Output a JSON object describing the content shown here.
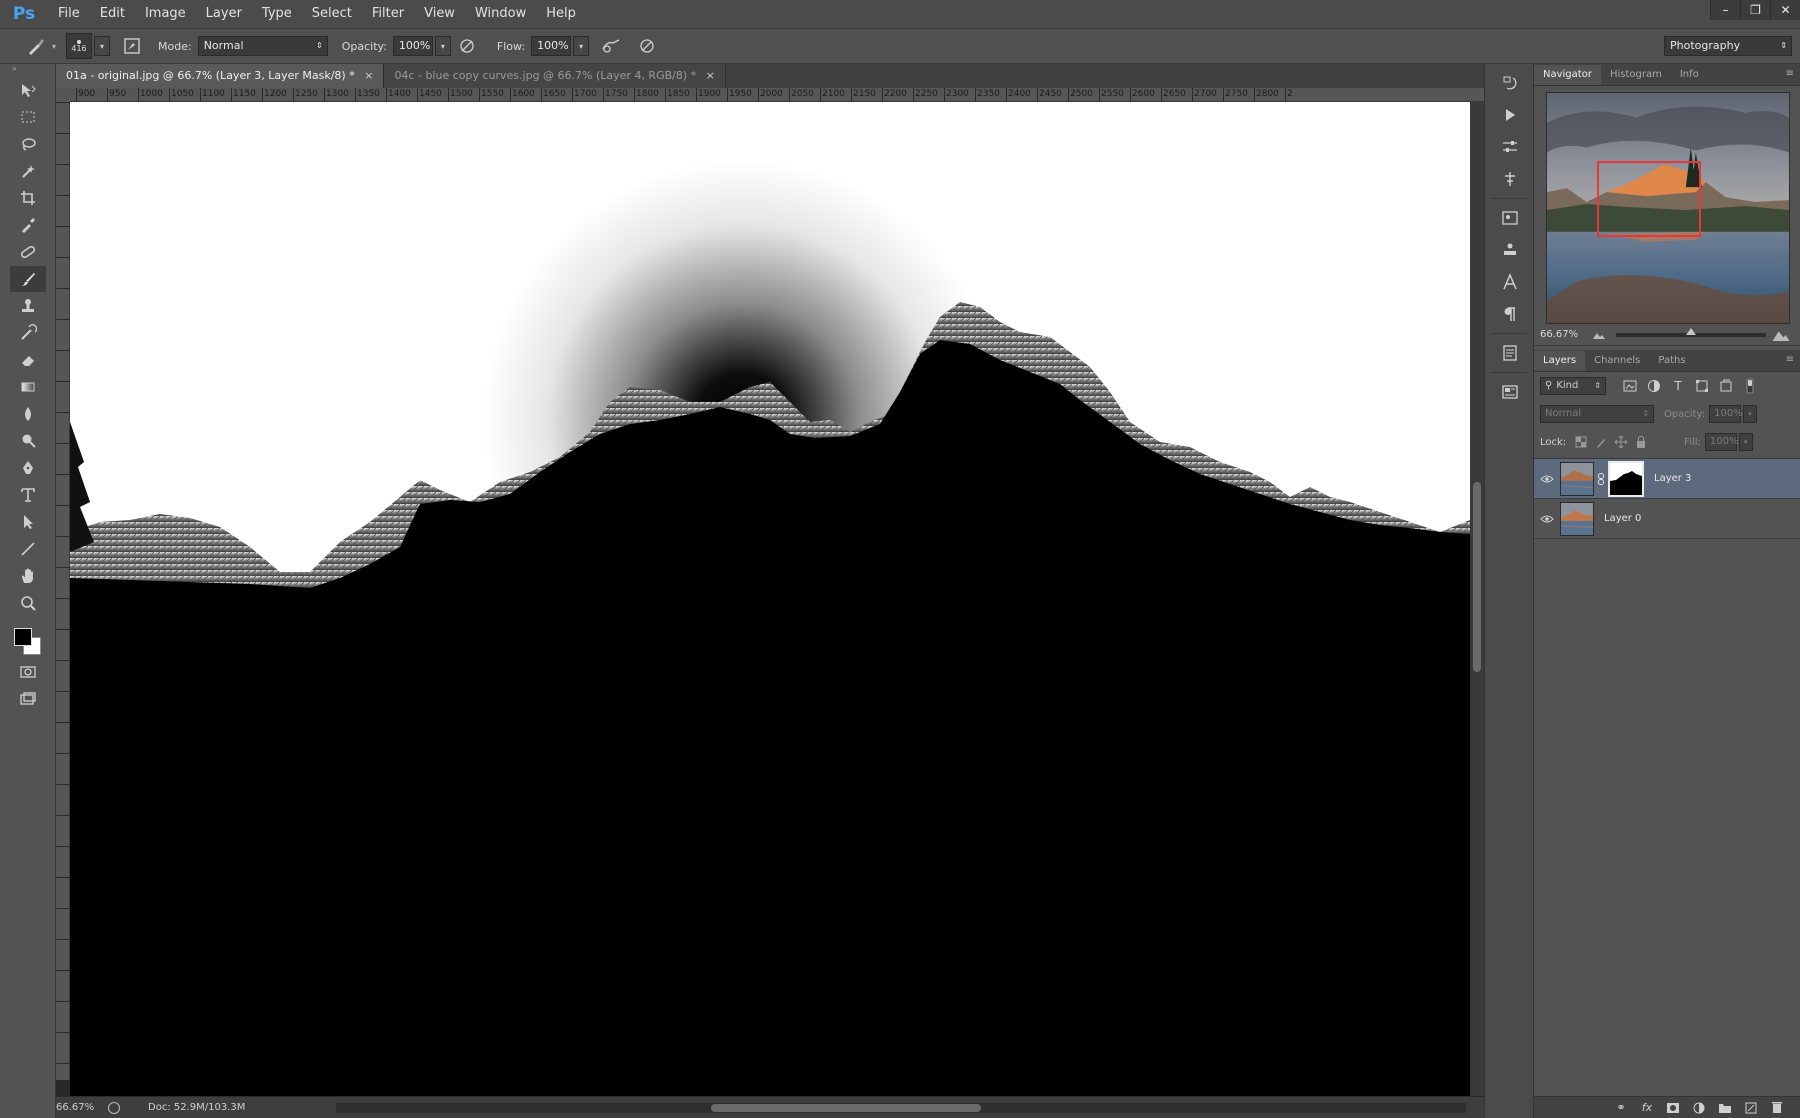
{
  "app": {
    "logo": "Ps",
    "menu": [
      "File",
      "Edit",
      "Image",
      "Layer",
      "Type",
      "Select",
      "Filter",
      "View",
      "Window",
      "Help"
    ],
    "window_controls": [
      "–",
      "❐",
      "✕"
    ]
  },
  "options_bar": {
    "brush_size": "416",
    "mode_label": "Mode:",
    "mode_value": "Normal",
    "opacity_label": "Opacity:",
    "opacity_value": "100%",
    "flow_label": "Flow:",
    "flow_value": "100%",
    "workspace": "Photography"
  },
  "tools": [
    "move-tool",
    "marquee-tool",
    "lasso-tool",
    "quick-select-tool",
    "crop-tool",
    "eyedropper-tool",
    "healing-brush-tool",
    "brush-tool",
    "clone-stamp-tool",
    "history-brush-tool",
    "eraser-tool",
    "gradient-tool",
    "blur-tool",
    "dodge-tool",
    "pen-tool",
    "type-tool",
    "path-select-tool",
    "line-tool",
    "hand-tool",
    "zoom-tool"
  ],
  "active_tool": "brush-tool",
  "colors": {
    "foreground": "#000000",
    "background": "#ffffff",
    "accent": "#4aa3f0",
    "nav_box": "#e8373b",
    "selected_layer": "#5d6a7e"
  },
  "document": {
    "tabs": [
      {
        "label": "01a - original.jpg @ 66.7% (Layer 3, Layer Mask/8) *",
        "active": true
      },
      {
        "label": "04c - blue copy curves.jpg @ 66.7% (Layer 4, RGB/8) *",
        "active": false
      }
    ],
    "close_glyph": "×",
    "ruler_labels": [
      "900",
      "950",
      "1000",
      "1050",
      "1100",
      "1150",
      "1200",
      "1250",
      "1300",
      "1350",
      "1400",
      "1450",
      "1500",
      "1550",
      "1600",
      "1650",
      "1700",
      "1750",
      "1800",
      "1850",
      "1900",
      "1950",
      "2000",
      "2050",
      "2100",
      "2150",
      "2200",
      "2250",
      "2300",
      "2350",
      "2400",
      "2450",
      "2500",
      "2550",
      "2600",
      "2650",
      "2700",
      "2750",
      "2800",
      "2"
    ],
    "status_zoom": "66.67%",
    "status_doc": "Doc: 52.9M/103.3M"
  },
  "navigator": {
    "tabs": [
      "Navigator",
      "Histogram",
      "Info"
    ],
    "zoom": "66.67%",
    "zoom_slider_position": 0.5
  },
  "layers": {
    "tabs": [
      "Layers",
      "Channels",
      "Paths"
    ],
    "filter_kind": "Kind",
    "blend_mode": "Normal",
    "opacity_label": "Opacity:",
    "opacity_value": "100%",
    "lock_label": "Lock:",
    "fill_label": "Fill:",
    "fill_value": "100%",
    "items": [
      {
        "name": "Layer 3",
        "visible": true,
        "selected": true,
        "has_mask": true
      },
      {
        "name": "Layer 0",
        "visible": true,
        "selected": false,
        "has_mask": false
      }
    ],
    "bottom_icons": [
      "link-icon",
      "fx-icon",
      "add-mask-icon",
      "adjustment-icon",
      "group-icon",
      "new-layer-icon",
      "trash-icon"
    ]
  }
}
